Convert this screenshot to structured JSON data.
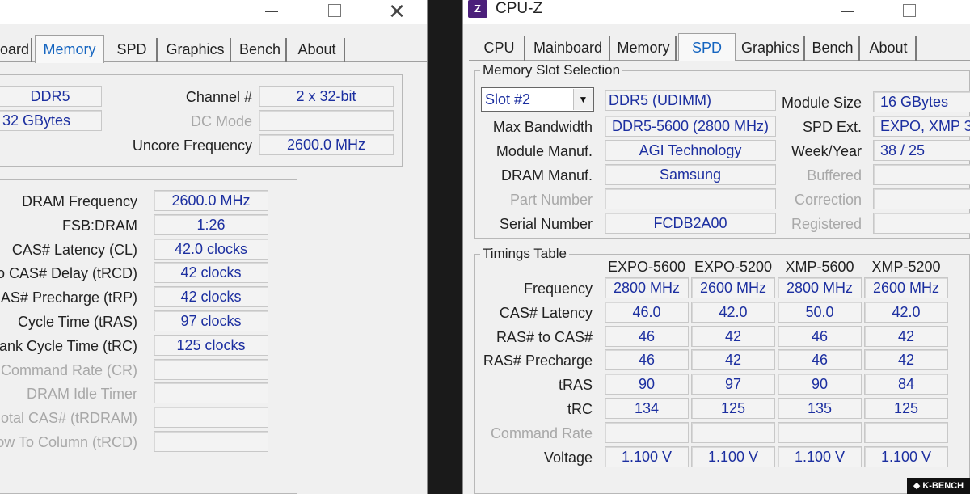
{
  "left_window": {
    "tabs": [
      "oard",
      "Memory",
      "SPD",
      "Graphics",
      "Bench",
      "About"
    ],
    "active_tab": "Memory",
    "general": {
      "type": "DDR5",
      "size": "32 GBytes",
      "channel_label": "Channel #",
      "channel_value": "2 x 32-bit",
      "dc_mode_label": "DC Mode",
      "dc_mode_value": "",
      "uncore_label": "Uncore Frequency",
      "uncore_value": "2600.0 MHz"
    },
    "timings": [
      {
        "label": "DRAM Frequency",
        "value": "2600.0 MHz",
        "disabled": false
      },
      {
        "label": "FSB:DRAM",
        "value": "1:26",
        "disabled": false
      },
      {
        "label": "CAS# Latency (CL)",
        "value": "42.0 clocks",
        "disabled": false
      },
      {
        "label": "o CAS# Delay (tRCD)",
        "value": "42 clocks",
        "disabled": false
      },
      {
        "label": "AS# Precharge (tRP)",
        "value": "42 clocks",
        "disabled": false
      },
      {
        "label": "Cycle Time (tRAS)",
        "value": "97 clocks",
        "disabled": false
      },
      {
        "label": "ank Cycle Time (tRC)",
        "value": "125 clocks",
        "disabled": false
      },
      {
        "label": "Command Rate (CR)",
        "value": "",
        "disabled": true
      },
      {
        "label": "DRAM Idle Timer",
        "value": "",
        "disabled": true
      },
      {
        "label": "otal CAS# (tRDRAM)",
        "value": "",
        "disabled": true
      },
      {
        "label": "ow To Column (tRCD)",
        "value": "",
        "disabled": true
      }
    ]
  },
  "right_window": {
    "title": "CPU-Z",
    "icon_text": "Z",
    "tabs": [
      "CPU",
      "Mainboard",
      "Memory",
      "SPD",
      "Graphics",
      "Bench",
      "About"
    ],
    "active_tab": "SPD",
    "slot_group_label": "Memory Slot Selection",
    "slot_select": "Slot #2",
    "memory_type": "DDR5 (UDIMM)",
    "left_fields": [
      {
        "label": "Max Bandwidth",
        "value": "DDR5-5600 (2800 MHz)",
        "disabled": false
      },
      {
        "label": "Module Manuf.",
        "value": "AGI Technology",
        "disabled": false
      },
      {
        "label": "DRAM Manuf.",
        "value": "Samsung",
        "disabled": false
      },
      {
        "label": "Part Number",
        "value": "",
        "disabled": true
      },
      {
        "label": "Serial Number",
        "value": "FCDB2A00",
        "disabled": false
      }
    ],
    "right_fields": [
      {
        "label": "Module Size",
        "value": "16 GBytes",
        "disabled": false
      },
      {
        "label": "SPD Ext.",
        "value": "EXPO, XMP 3.",
        "disabled": false
      },
      {
        "label": "Week/Year",
        "value": "38 / 25",
        "disabled": false
      },
      {
        "label": "Buffered",
        "value": "",
        "disabled": true
      },
      {
        "label": "Correction",
        "value": "",
        "disabled": true
      },
      {
        "label": "Registered",
        "value": "",
        "disabled": true
      }
    ],
    "timings_group_label": "Timings Table",
    "timing_columns": [
      "EXPO-5600",
      "EXPO-5200",
      "XMP-5600",
      "XMP-5200"
    ],
    "timing_rows": [
      {
        "label": "Frequency",
        "values": [
          "2800 MHz",
          "2600 MHz",
          "2800 MHz",
          "2600 MHz"
        ],
        "disabled": false
      },
      {
        "label": "CAS# Latency",
        "values": [
          "46.0",
          "42.0",
          "50.0",
          "42.0"
        ],
        "disabled": false
      },
      {
        "label": "RAS# to CAS#",
        "values": [
          "46",
          "42",
          "46",
          "42"
        ],
        "disabled": false
      },
      {
        "label": "RAS# Precharge",
        "values": [
          "46",
          "42",
          "46",
          "42"
        ],
        "disabled": false
      },
      {
        "label": "tRAS",
        "values": [
          "90",
          "97",
          "90",
          "84"
        ],
        "disabled": false
      },
      {
        "label": "tRC",
        "values": [
          "134",
          "125",
          "135",
          "125"
        ],
        "disabled": false
      },
      {
        "label": "Command Rate",
        "values": [
          "",
          "",
          "",
          ""
        ],
        "disabled": true
      },
      {
        "label": "Voltage",
        "values": [
          "1.100 V",
          "1.100 V",
          "1.100 V",
          "1.100 V"
        ],
        "disabled": false
      }
    ]
  },
  "watermark": "K-BENCH"
}
